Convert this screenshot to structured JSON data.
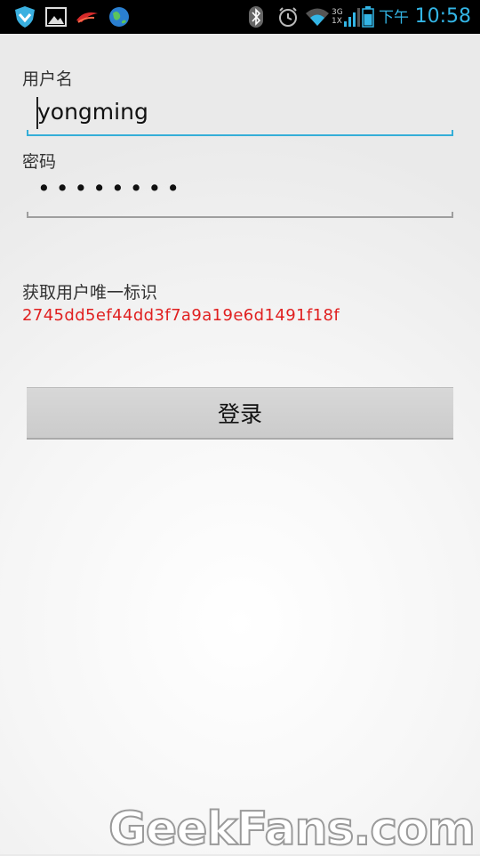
{
  "status_bar": {
    "icons": [
      "shield-icon",
      "gallery-icon",
      "app-icon",
      "globe-icon",
      "bluetooth-icon",
      "alarm-icon",
      "wifi-icon",
      "signal-icon",
      "battery-icon"
    ],
    "network_labels": [
      "3G",
      "1X"
    ],
    "ampm": "下午",
    "time": "10:58",
    "accent_color": "#33b5e5"
  },
  "form": {
    "username_label": "用户名",
    "username_value": "yongming",
    "password_label": "密码",
    "password_masked": "••••••••",
    "uid_label": "获取用户唯一标识",
    "uid_value": "2745dd5ef44dd3f7a9a19e6d1491f18f",
    "uid_color": "#e02020",
    "login_button": "登录"
  },
  "watermark": "GeekFans.com"
}
